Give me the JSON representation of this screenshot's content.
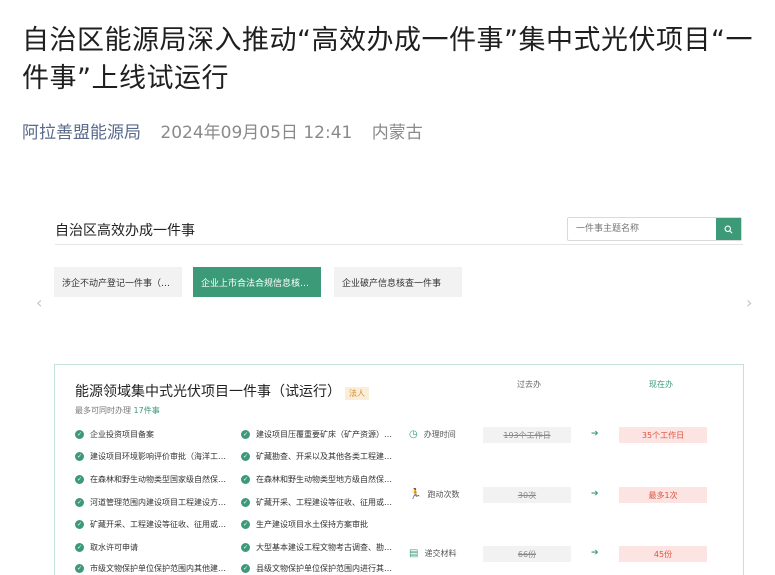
{
  "article": {
    "title": "自治区能源局深入推动“高效办成一件事”集中式光伏项目“一件事”上线试运行",
    "source": "阿拉善盟能源局",
    "date": "2024年09月05日 12:41",
    "region": "内蒙古"
  },
  "portal": {
    "title": "自治区高效办成一件事",
    "search_placeholder": "一件事主题名称",
    "tabs": [
      {
        "label": "涉企不动产登记一件事（…"
      },
      {
        "label": "企业上市合法合规信息核…"
      },
      {
        "label": "企业破产信息核查一件事"
      }
    ]
  },
  "card": {
    "title": "能源领域集中式光伏项目一件事（试运行）",
    "badge": "法人",
    "sub_prefix": "最多可同时办理",
    "sub_count": "17件事",
    "col_past": "过去办",
    "col_now": "现在办",
    "processes_left": [
      "企业投资项目备案",
      "建设项目环境影响评价审批（海洋工…",
      "在森林和野生动物类型国家级自然保…",
      "河道管理范围内建设项目工程建设方…",
      "矿藏开采、工程建设等征收、征用或…",
      "取水许可申请",
      "市级文物保护单位保护范围内其他建…"
    ],
    "processes_right": [
      "建设项目压覆重要矿床（矿产资源）…",
      "矿藏勘查、开采以及其他各类工程建…",
      "在森林和野生动物类型地方级自然保…",
      "矿藏开采、工程建设等征收、征用或…",
      "生产建设项目水土保持方案审批",
      "大型基本建设工程文物考古调查、勘…",
      "县级文物保护单位保护范围内进行其…"
    ],
    "metrics": [
      {
        "label": "办理时间",
        "past": "193个工作日",
        "now": "35个工作日",
        "icon": "clock-icon"
      },
      {
        "label": "跑动次数",
        "past": "30次",
        "now": "最多1次",
        "icon": "running-icon"
      },
      {
        "label": "递交材料",
        "past": "66份",
        "now": "45份",
        "icon": "document-icon"
      }
    ]
  },
  "colors": {
    "accent": "#3d9a78",
    "now_bg": "#fbe4e1",
    "now_text": "#e0523f"
  }
}
